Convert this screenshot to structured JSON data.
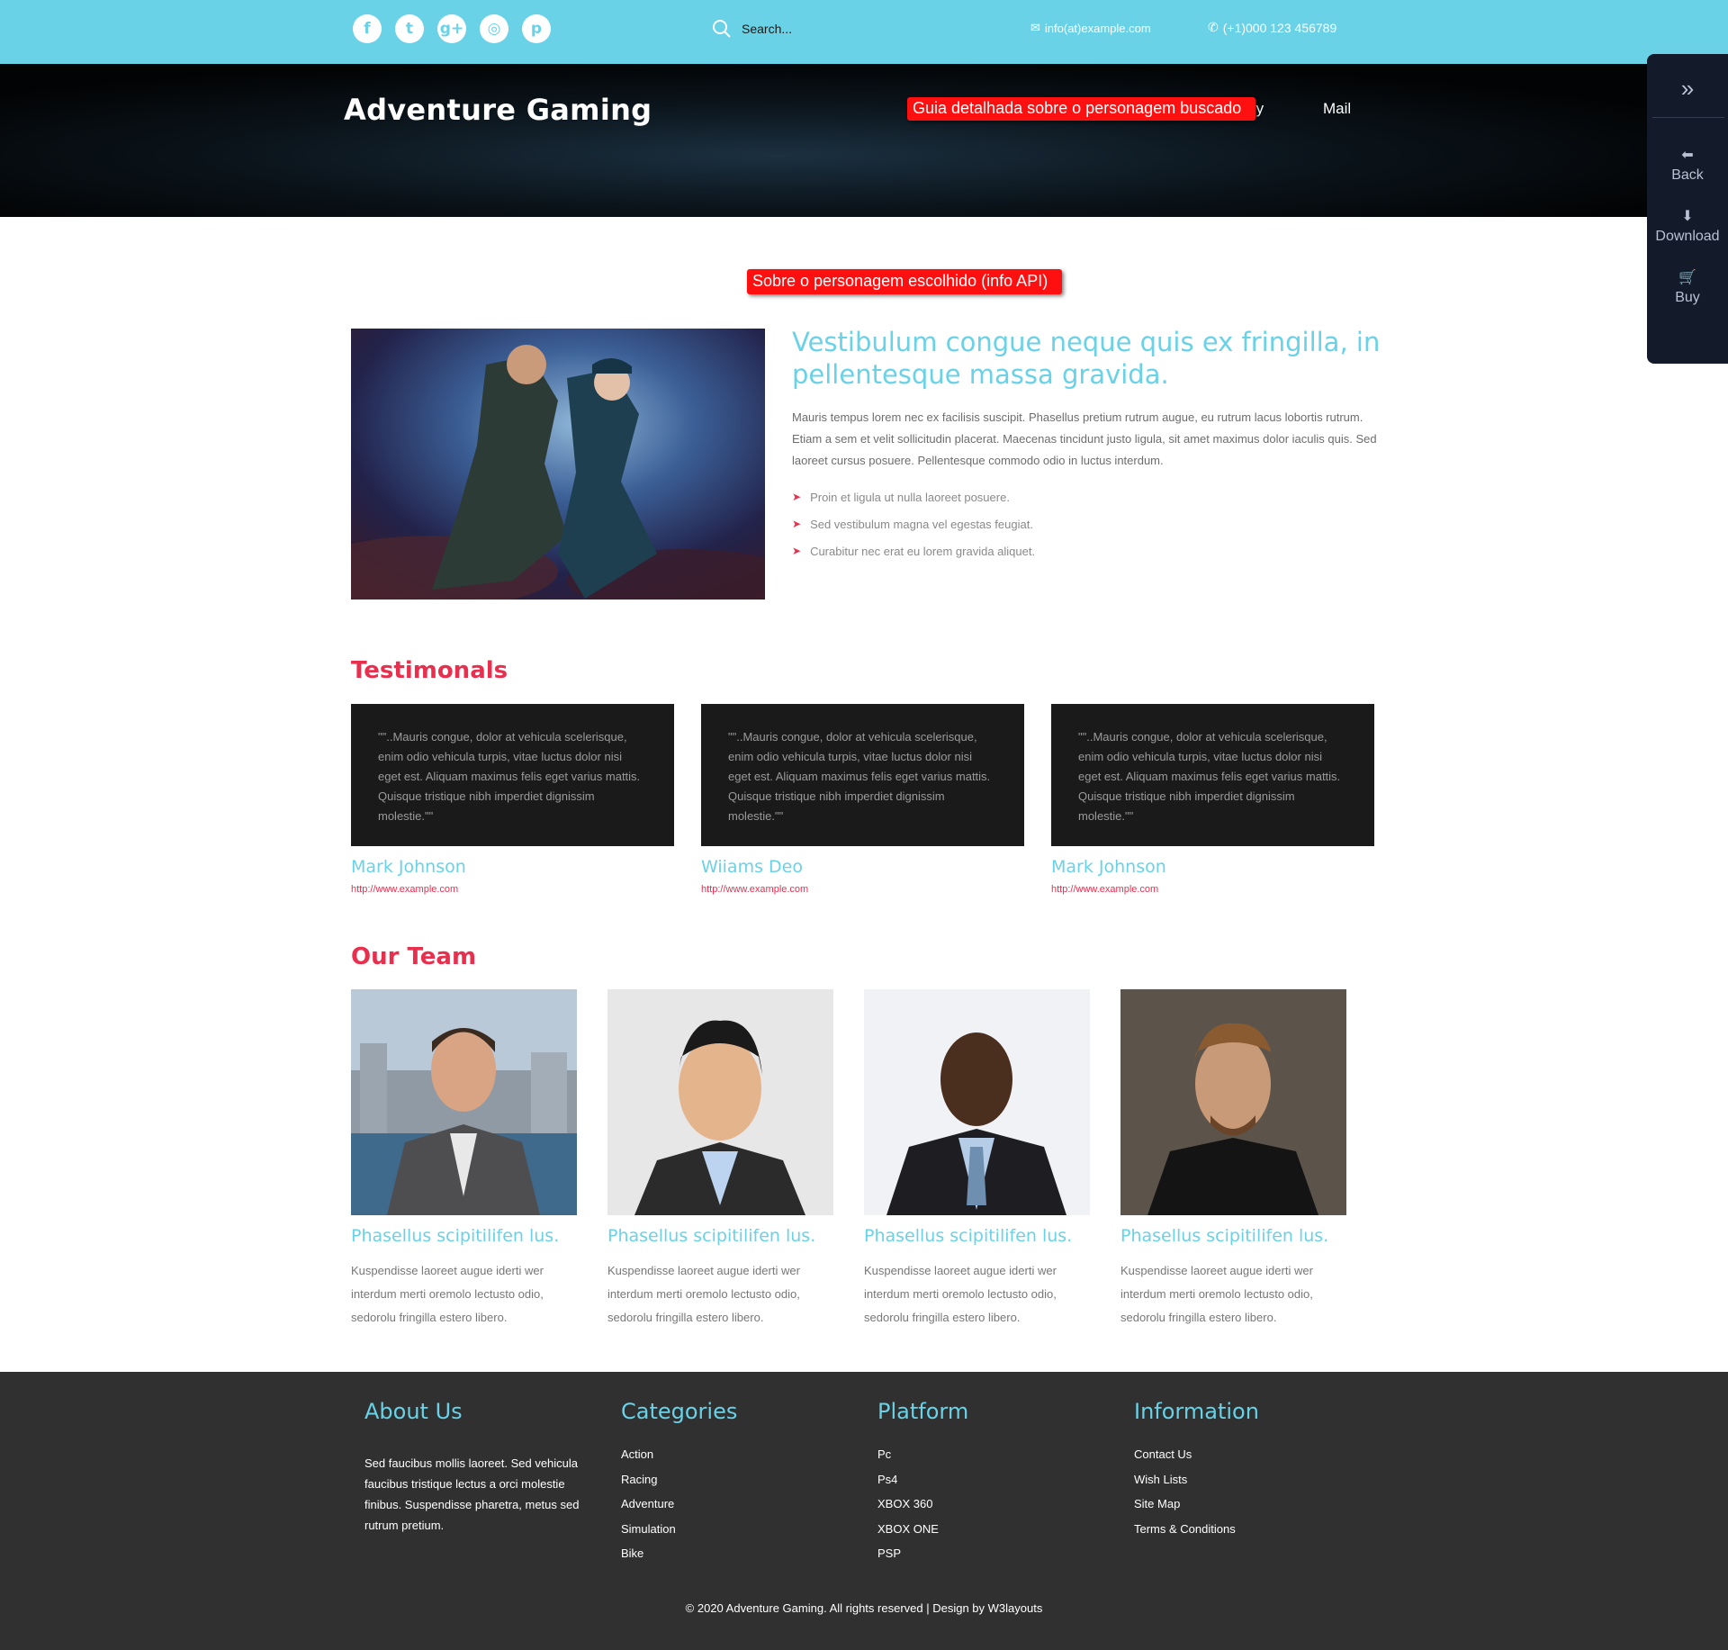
{
  "topbar": {
    "social": [
      {
        "icon": "facebook-icon",
        "glyph": "f"
      },
      {
        "icon": "twitter-icon",
        "glyph": "t"
      },
      {
        "icon": "google-plus-icon",
        "glyph": "g+"
      },
      {
        "icon": "instagram-icon",
        "glyph": "◎"
      },
      {
        "icon": "pinterest-icon",
        "glyph": "p"
      }
    ],
    "search_placeholder": "Search...",
    "email": "info(at)example.com",
    "phone": "(+1)000 123 456789"
  },
  "header": {
    "brand": "Adventure Gaming",
    "nav_partial": "ry",
    "nav_mail": "Mail"
  },
  "tooltips": {
    "guide": "Guia detalhada sobre o personagem buscado",
    "about_api": "Sobre o personagem escolhido (info API)"
  },
  "sidepanel": {
    "toggle_icon": "»",
    "back": "Back",
    "download": "Download",
    "buy": "Buy"
  },
  "about": {
    "title": "Vestibulum congue neque quis ex fringilla, in pellentesque massa gravida.",
    "text": "Mauris tempus lorem nec ex facilisis suscipit. Phasellus pretium rutrum augue, eu rutrum lacus lobortis rutrum. Etiam a sem et velit sollicitudin placerat. Maecenas tincidunt justo ligula, sit amet maximus dolor iaculis quis. Sed laoreet cursus posuere. Pellentesque commodo odio in luctus interdum.",
    "bullets": [
      "Proin et ligula ut nulla laoreet posuere.",
      "Sed vestibulum magna vel egestas feugiat.",
      "Curabitur nec erat eu lorem gravida aliquet."
    ]
  },
  "testimonials": {
    "title": "Testimonals",
    "items": [
      {
        "quote": "\"\"..Mauris congue, dolor at vehicula scelerisque, enim odio vehicula turpis, vitae luctus dolor nisi eget est. Aliquam maximus felis eget varius mattis. Quisque tristique nibh imperdiet dignissim molestie.\"\"",
        "name": "Mark Johnson",
        "link": "http://www.example.com"
      },
      {
        "quote": "\"\"..Mauris congue, dolor at vehicula scelerisque, enim odio vehicula turpis, vitae luctus dolor nisi eget est. Aliquam maximus felis eget varius mattis. Quisque tristique nibh imperdiet dignissim molestie.\"\"",
        "name": "Wiiams Deo",
        "link": "http://www.example.com"
      },
      {
        "quote": "\"\"..Mauris congue, dolor at vehicula scelerisque, enim odio vehicula turpis, vitae luctus dolor nisi eget est. Aliquam maximus felis eget varius mattis. Quisque tristique nibh imperdiet dignissim molestie.\"\"",
        "name": "Mark Johnson",
        "link": "http://www.example.com"
      }
    ]
  },
  "team": {
    "title": "Our Team",
    "members": [
      {
        "name": "Phasellus scipitilifen lus.",
        "text": "Kuspendisse laoreet augue iderti wer interdum merti oremolo lectusto odio, sedorolu fringilla estero libero."
      },
      {
        "name": "Phasellus scipitilifen lus.",
        "text": "Kuspendisse laoreet augue iderti wer interdum merti oremolo lectusto odio, sedorolu fringilla estero libero."
      },
      {
        "name": "Phasellus scipitilifen lus.",
        "text": "Kuspendisse laoreet augue iderti wer interdum merti oremolo lectusto odio, sedorolu fringilla estero libero."
      },
      {
        "name": "Phasellus scipitilifen lus.",
        "text": "Kuspendisse laoreet augue iderti wer interdum merti oremolo lectusto odio, sedorolu fringilla estero libero."
      }
    ]
  },
  "footer": {
    "about_title": "About Us",
    "about_text": "Sed faucibus mollis laoreet. Sed vehicula faucibus tristique lectus a orci molestie finibus. Suspendisse pharetra, metus sed rutrum pretium.",
    "categories_title": "Categories",
    "categories": [
      "Action",
      "Racing",
      "Adventure",
      "Simulation",
      "Bike"
    ],
    "platform_title": "Platform",
    "platforms": [
      "Pc",
      "Ps4",
      "XBOX 360",
      "XBOX ONE",
      "PSP"
    ],
    "information_title": "Information",
    "information": [
      "Contact Us",
      "Wish Lists",
      "Site Map",
      "Terms & Conditions"
    ],
    "copyright": "© 2020 Adventure Gaming. All rights reserved | Design by W3layouts"
  },
  "colors": {
    "accent_cyan": "#69d2e7",
    "accent_red": "#e8304e",
    "tooltip_red": "#ff1010",
    "footer_bg": "#303030",
    "card_bg": "#1a1a1a",
    "panel_bg": "#131a29"
  }
}
